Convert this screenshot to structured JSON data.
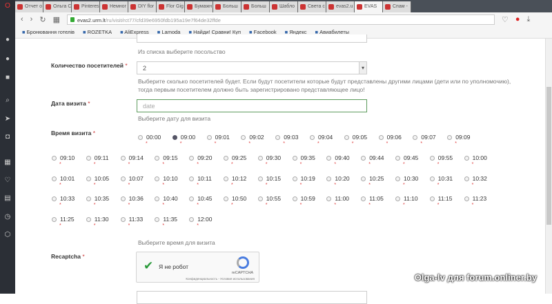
{
  "browser": {
    "tabs": [
      "Отчет о",
      "Ольга С",
      "Pinterest",
      "Немног",
      "DIY flor",
      "Flor Gig",
      "Бумажн",
      "Больш",
      "Больш",
      "Шабло",
      "Света с",
      "evas2.u",
      "EVAS",
      "Спам -"
    ],
    "url_host": "evas2.urm.lt",
    "url_path": "/ru/visit/rct77/cfd39e6950fdb195a19e7f64de32ffde",
    "bookmarks": [
      "Бронювання готелів",
      "ROZETKA",
      "AliExpress",
      "Lamoda",
      "Найди! Сравни! Куп",
      "Facebook",
      "Яндекс",
      "Авиабилеты"
    ]
  },
  "form": {
    "embassy_hint": "Из списка выберите посольство",
    "visitors_label": "Количество посетителей",
    "visitors_value": "2",
    "visitors_hint": "Выберите сколько посетителей будет. Если будут посетители которые будут представлены другими лицами (дети или по уполномочию), тогда первым посетителем должно быть зарегистрировано представляющее лицо!",
    "date_label": "Дата визита",
    "date_placeholder": "date",
    "date_hint": "Выберите дату для визита",
    "time_label": "Время визита",
    "selected_time": "09:00",
    "times": [
      "00:00",
      "09:00",
      "09:01",
      "09:02",
      "09:03",
      "09:04",
      "09:05",
      "09:06",
      "09:07",
      "09:09",
      "09:10",
      "09:11",
      "09:14",
      "09:15",
      "09:20",
      "09:25",
      "09:30",
      "09:35",
      "09:40",
      "09:44",
      "09:45",
      "09:55",
      "10:00",
      "10:01",
      "10:05",
      "10:07",
      "10:10",
      "10:11",
      "10:12",
      "10:15",
      "10:19",
      "10:20",
      "10:25",
      "10:30",
      "10:31",
      "10:32",
      "10:33",
      "10:35",
      "10:36",
      "10:40",
      "10:45",
      "10:50",
      "10:55",
      "10:59",
      "11:00",
      "11:05",
      "11:10",
      "11:15",
      "11:23",
      "11:25",
      "11:30",
      "11:33",
      "11:35",
      "12:00"
    ],
    "time_hint": "Выберите время для визита",
    "recaptcha_label": "Recaptcha",
    "captcha_text": "Я не робот",
    "captcha_brand": "reCAPTCHA",
    "captcha_privacy": "Конфиденциальность - Условия использования",
    "required_mark": "*"
  },
  "watermark": "Olga-lv для forum.onliner.by"
}
